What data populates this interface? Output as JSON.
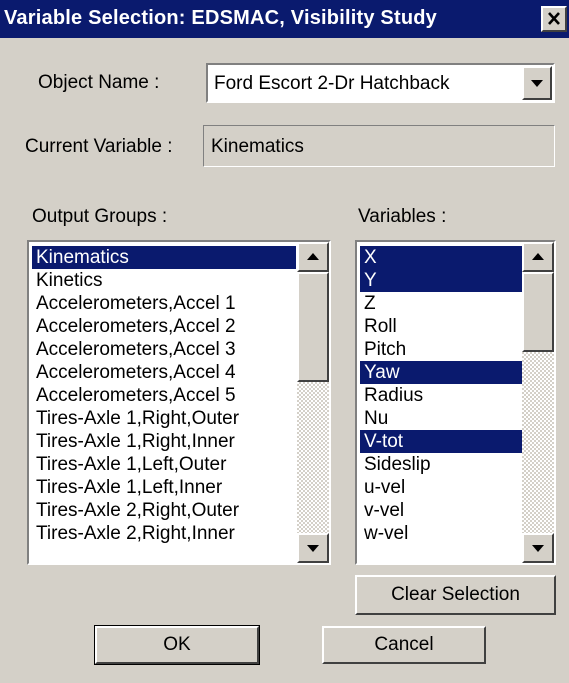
{
  "window": {
    "title": "Variable Selection: EDSMAC, Visibility Study",
    "close_icon": "close-x-icon"
  },
  "object_name": {
    "label": "Object Name :",
    "value": "Ford Escort 2-Dr Hatchback",
    "dropdown_icon": "chevron-down-icon"
  },
  "current_variable": {
    "label": "Current Variable :",
    "value": "Kinematics"
  },
  "output_groups": {
    "label": "Output Groups :",
    "items": [
      {
        "label": "Kinematics",
        "selected": true
      },
      {
        "label": "Kinetics",
        "selected": false
      },
      {
        "label": "Accelerometers,Accel 1",
        "selected": false
      },
      {
        "label": "Accelerometers,Accel 2",
        "selected": false
      },
      {
        "label": "Accelerometers,Accel 3",
        "selected": false
      },
      {
        "label": "Accelerometers,Accel 4",
        "selected": false
      },
      {
        "label": "Accelerometers,Accel 5",
        "selected": false
      },
      {
        "label": "Tires-Axle 1,Right,Outer",
        "selected": false
      },
      {
        "label": "Tires-Axle 1,Right,Inner",
        "selected": false
      },
      {
        "label": "Tires-Axle 1,Left,Outer",
        "selected": false
      },
      {
        "label": "Tires-Axle 1,Left,Inner",
        "selected": false
      },
      {
        "label": "Tires-Axle 2,Right,Outer",
        "selected": false
      },
      {
        "label": "Tires-Axle 2,Right,Inner",
        "selected": false
      }
    ]
  },
  "variables": {
    "label": "Variables :",
    "items": [
      {
        "label": "X",
        "selected": true
      },
      {
        "label": "Y",
        "selected": true
      },
      {
        "label": "Z",
        "selected": false
      },
      {
        "label": "Roll",
        "selected": false
      },
      {
        "label": "Pitch",
        "selected": false
      },
      {
        "label": "Yaw",
        "selected": true
      },
      {
        "label": "Radius",
        "selected": false
      },
      {
        "label": "Nu",
        "selected": false
      },
      {
        "label": "V-tot",
        "selected": true
      },
      {
        "label": "Sideslip",
        "selected": false
      },
      {
        "label": "u-vel",
        "selected": false
      },
      {
        "label": "v-vel",
        "selected": false
      },
      {
        "label": "w-vel",
        "selected": false
      }
    ]
  },
  "buttons": {
    "clear_selection": "Clear Selection",
    "ok": "OK",
    "cancel": "Cancel"
  }
}
